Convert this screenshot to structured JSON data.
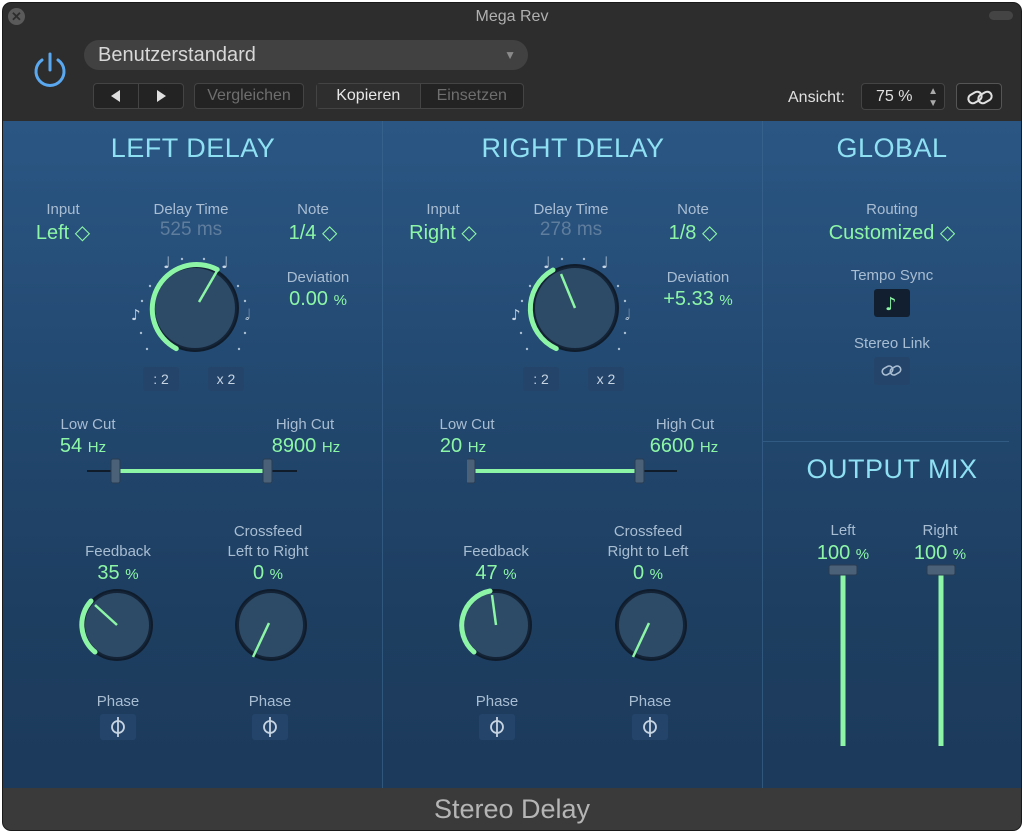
{
  "window": {
    "title": "Mega Rev"
  },
  "header": {
    "preset": "Benutzerstandard",
    "prev_icon": "triangle-left-icon",
    "next_icon": "triangle-right-icon",
    "compare_label": "Vergleichen",
    "copy_label": "Kopieren",
    "paste_label": "Einsetzen",
    "view_label": "Ansicht:",
    "zoom": "75 %"
  },
  "colors": {
    "accent_green": "#8cf6a6",
    "title_cyan": "#8ee0f2",
    "power_blue": "#5aa8f0"
  },
  "left_delay": {
    "title": "LEFT DELAY",
    "input_label": "Input",
    "input_value": "Left ◇",
    "delay_label": "Delay Time",
    "delay_value": "525 ms",
    "note_label": "Note",
    "note_value": "1/4 ◇",
    "deviation_label": "Deviation",
    "deviation_value": "0.00",
    "deviation_unit": "%",
    "div_label": ": 2",
    "mul_label": "x 2",
    "lowcut_label": "Low Cut",
    "lowcut_value": "54",
    "lowcut_unit": "Hz",
    "highcut_label": "High Cut",
    "highcut_value": "8900",
    "highcut_unit": "Hz",
    "feedback_label": "Feedback",
    "feedback_value": "35",
    "feedback_unit": "%",
    "crossfeed_label1": "Crossfeed",
    "crossfeed_label2": "Left to Right",
    "crossfeed_value": "0",
    "crossfeed_unit": "%",
    "phase_label": "Phase"
  },
  "right_delay": {
    "title": "RIGHT DELAY",
    "input_label": "Input",
    "input_value": "Right ◇",
    "delay_label": "Delay Time",
    "delay_value": "278 ms",
    "note_label": "Note",
    "note_value": "1/8 ◇",
    "deviation_label": "Deviation",
    "deviation_value": "+5.33",
    "deviation_unit": "%",
    "div_label": ": 2",
    "mul_label": "x 2",
    "lowcut_label": "Low Cut",
    "lowcut_value": "20",
    "lowcut_unit": "Hz",
    "highcut_label": "High Cut",
    "highcut_value": "6600",
    "highcut_unit": "Hz",
    "feedback_label": "Feedback",
    "feedback_value": "47",
    "feedback_unit": "%",
    "crossfeed_label1": "Crossfeed",
    "crossfeed_label2": "Right to Left",
    "crossfeed_value": "0",
    "crossfeed_unit": "%",
    "phase_label": "Phase"
  },
  "global": {
    "title": "GLOBAL",
    "routing_label": "Routing",
    "routing_value": "Customized ◇",
    "tempo_sync_label": "Tempo Sync",
    "stereo_link_label": "Stereo Link"
  },
  "output_mix": {
    "title": "OUTPUT MIX",
    "left_label": "Left",
    "left_value": "100",
    "left_unit": "%",
    "right_label": "Right",
    "right_value": "100",
    "right_unit": "%"
  },
  "footer": {
    "plugin_name": "Stereo Delay"
  }
}
